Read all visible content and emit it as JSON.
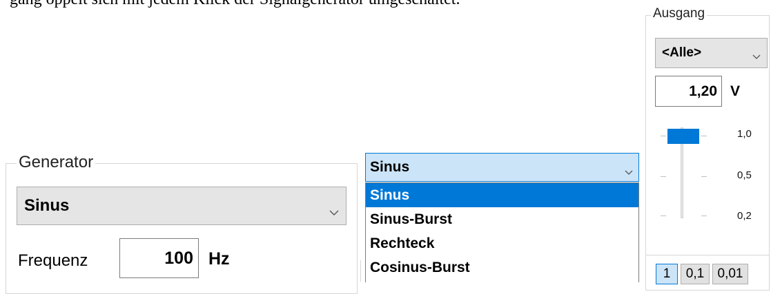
{
  "top_note": "gang oppelt sich mit jedem Klick der Signalgenerator umgeschaltet.",
  "generator": {
    "title": "Generator",
    "waveform_value": "Sinus",
    "frequency_label": "Frequenz",
    "frequency_value": "100",
    "frequency_unit": "Hz"
  },
  "waveform_dropdown": {
    "selected": "Sinus",
    "options": [
      "Sinus",
      "Sinus-Burst",
      "Rechteck",
      "Cosinus-Burst"
    ],
    "highlighted_index": 0
  },
  "output": {
    "title": "Ausgang",
    "channel_value": "<Alle>",
    "amplitude_value": "1,20",
    "amplitude_unit": "V",
    "scale_labels": [
      "1,0",
      "0,5",
      "0,2"
    ],
    "step_buttons": [
      "1",
      "0,1",
      "0,01"
    ],
    "active_step_index": 0
  },
  "colors": {
    "highlight": "#0078d7",
    "combo_selected_bg": "#cce4f7"
  }
}
